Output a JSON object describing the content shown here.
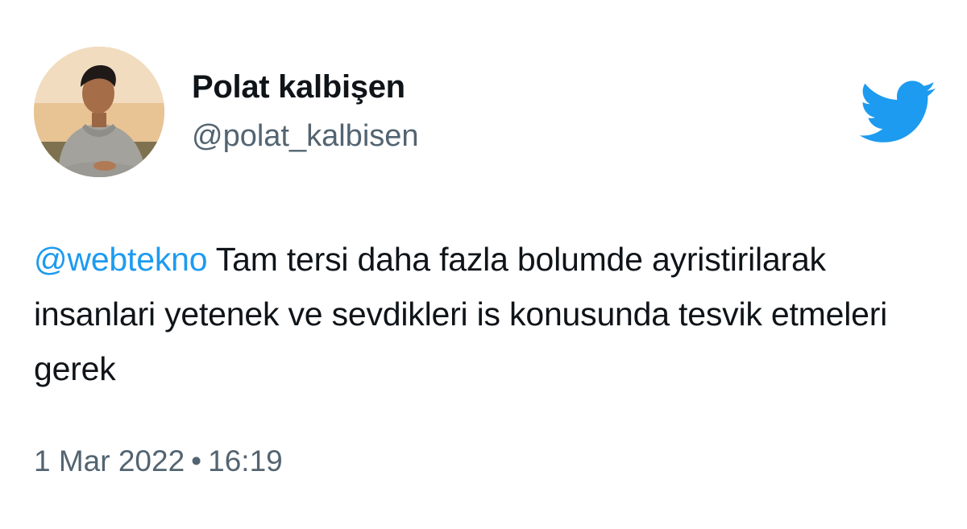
{
  "user": {
    "display_name": "Polat kalbişen",
    "handle": "@polat_kalbisen",
    "avatar_icon": "profile-photo"
  },
  "logo": {
    "icon": "twitter-bird-icon",
    "color": "#1d9bf0"
  },
  "tweet": {
    "mention": "@webtekno",
    "body": " Tam tersi daha fazla bolumde ayristirilarak insanlari yetenek ve sevdikleri is konusunda tesvik etmeleri gerek"
  },
  "meta": {
    "date": "1 Mar 2022",
    "separator": "•",
    "time": "16:19"
  },
  "colors": {
    "text": "#0f1419",
    "secondary": "#536471",
    "accent": "#1d9bf0",
    "background": "#ffffff"
  }
}
